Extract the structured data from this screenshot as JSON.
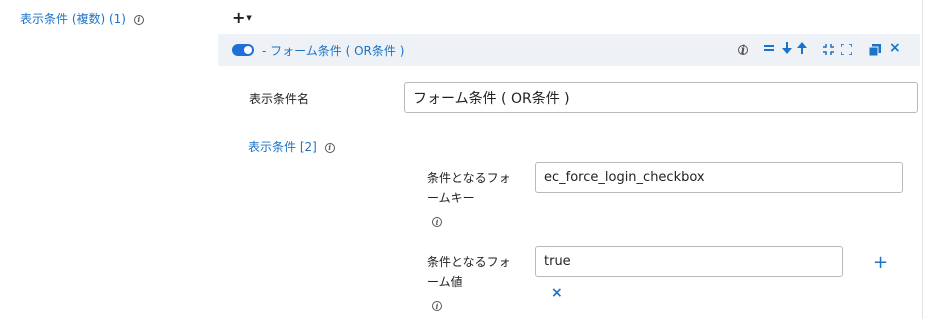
{
  "section": {
    "label": "表示条件 (複数) (1)",
    "add_menu_label": "+"
  },
  "condition": {
    "toggle_on": true,
    "title": "- フォーム条件 ( OR条件 )",
    "header_icons": [
      "info-icon",
      "menu-lines-icon",
      "arrow-down-icon",
      "arrow-up-icon",
      "collapse-icon",
      "expand-icon",
      "copy-icon",
      "close-icon"
    ],
    "name_label": "表示条件名",
    "name_value": "フォーム条件 ( OR条件 )",
    "conditions_label": "表示条件 [2]",
    "form_key_label_line1": "条件となるフォ",
    "form_key_label_line2": "ームキー",
    "form_key_value": "ec_force_login_checkbox",
    "form_value_label_line1": "条件となるフォ",
    "form_value_label_line2": "ーム値",
    "form_value_value": "true"
  },
  "colors": {
    "accent": "#1a73c8",
    "toggle": "#1f6fd6",
    "header_bg": "#eef2f6"
  }
}
